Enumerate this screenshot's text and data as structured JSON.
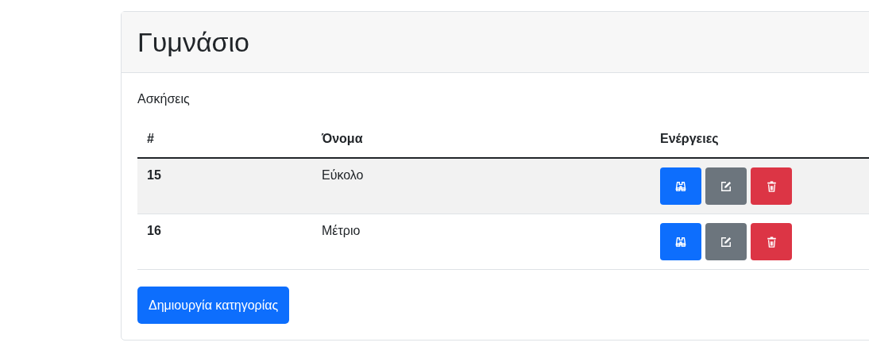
{
  "card": {
    "title": "Γυμνάσιο",
    "subtitle": "Ασκήσεις"
  },
  "table": {
    "columns": [
      "#",
      "Όνομα",
      "Ενέργειες"
    ],
    "rows": [
      {
        "id": "15",
        "name": "Εύκολο",
        "striped": true
      },
      {
        "id": "16",
        "name": "Μέτριο",
        "striped": false
      }
    ]
  },
  "create_button": "Δημιουργία κατηγορίας"
}
